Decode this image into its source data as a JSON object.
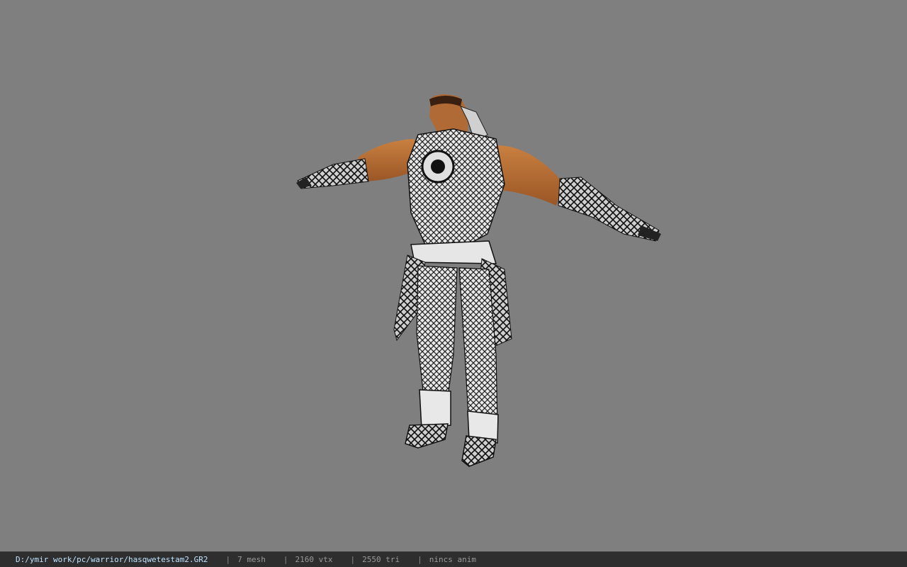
{
  "viewer": {
    "background_color": "#7f7f7f",
    "model": {
      "description_icon": "warrior-model",
      "skin_color": "#b86e38",
      "armor_color": "#d8d8d8",
      "armor_dark_color": "#1a1a1a"
    }
  },
  "status_bar": {
    "file_path": "D:/ymir work/pc/warrior/hasqwetestam2.GR2",
    "separator": "|",
    "mesh_count": "7 mesh",
    "vertex_count": "2160 vtx",
    "triangle_count": "2550 tri",
    "animation": "nincs anim",
    "path_color": "#bfe3ff",
    "bar_color": "#2e2e2e"
  }
}
